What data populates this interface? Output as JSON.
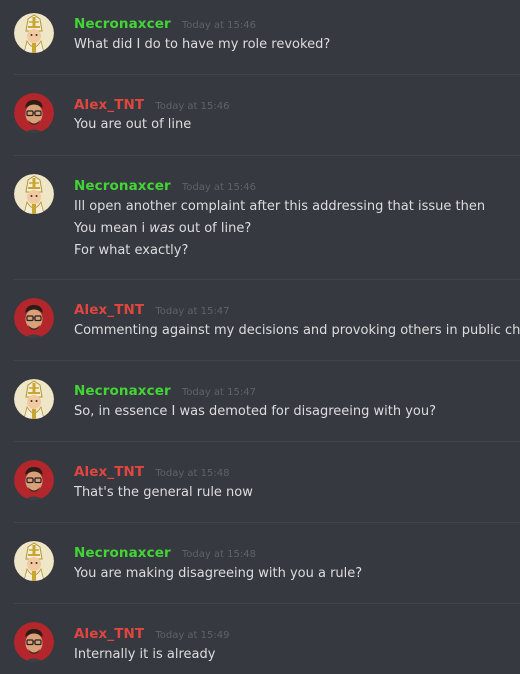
{
  "messages": [
    {
      "author": "Necronaxcer",
      "timestamp": "Today at 15:46",
      "lines": [
        "What did I do to have my role revoked?"
      ]
    },
    {
      "author": "Alex_TNT",
      "timestamp": "Today at 15:46",
      "lines": [
        "You are out of line"
      ]
    },
    {
      "author": "Necronaxcer",
      "timestamp": "Today at 15:46",
      "lines": [
        "Ill open another complaint after this addressing that issue then",
        "You mean i ",
        "was",
        " out of line?",
        "For what exactly?"
      ]
    },
    {
      "author": "Alex_TNT",
      "timestamp": "Today at 15:47",
      "lines": [
        "Commenting against my decisions and provoking others in public chat"
      ]
    },
    {
      "author": "Necronaxcer",
      "timestamp": "Today at 15:47",
      "lines": [
        "So, in essence I was demoted for disagreeing with you?"
      ]
    },
    {
      "author": "Alex_TNT",
      "timestamp": "Today at 15:48",
      "lines": [
        "That's the general rule now"
      ]
    },
    {
      "author": "Necronaxcer",
      "timestamp": "Today at 15:48",
      "lines": [
        "You are making disagreeing with you a rule?"
      ]
    },
    {
      "author": "Alex_TNT",
      "timestamp": "Today at 15:49",
      "lines": [
        "Internally it is already"
      ]
    }
  ],
  "colors": {
    "background": "#36393f",
    "necronaxcer_name": "#43d535",
    "alex_name": "#e0463f",
    "message_text": "#dcddde",
    "timestamp": "#5f6268"
  },
  "icons": {
    "necronaxcer_avatar": "pope-emoji-avatar-icon",
    "alex_avatar": "glasses-man-avatar-icon"
  }
}
